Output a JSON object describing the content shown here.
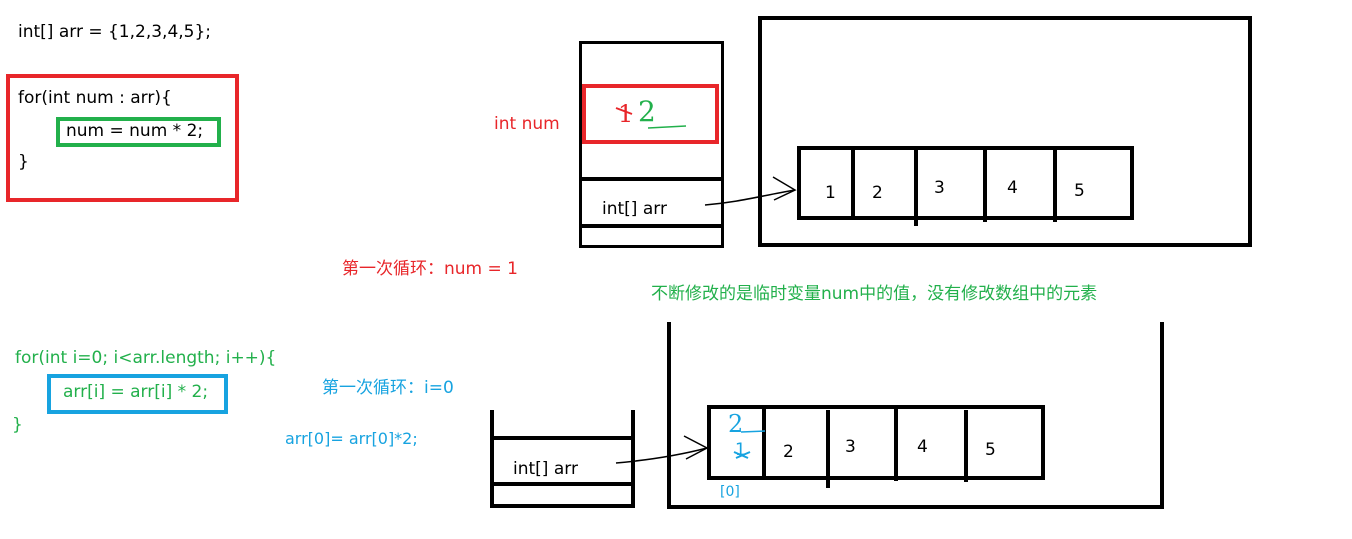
{
  "colors": {
    "black": "#000000",
    "red": "#e8262a",
    "green": "#22b04b",
    "blue": "#17a3e0"
  },
  "code_top": {
    "declaration": "int[] arr = {1,2,3,4,5};",
    "for_line": "for(int num : arr){",
    "body": "num = num * 2;",
    "close": "}"
  },
  "code_bottom": {
    "for_line": "for(int i=0; i<arr.length; i++){",
    "body": "arr[i] = arr[i] * 2;",
    "close": "}"
  },
  "labels": {
    "int_num": "int num",
    "loop1_num": "第一次循环：num = 1",
    "note": "不断修改的是临时变量num中的值，没有修改数组中的元素",
    "loop1_i": "第一次循环：i=0",
    "assign": "arr[0]= arr[0]*2;",
    "index0": "[0]"
  },
  "stack_top": {
    "num_value_old": "1",
    "num_value_new": "2",
    "arr_label": "int[] arr"
  },
  "stack_bottom": {
    "arr_label": "int[] arr"
  },
  "array_top": [
    "1",
    "2",
    "3",
    "4",
    "5"
  ],
  "array_bottom": {
    "first_old": "1",
    "first_new": "2",
    "rest": [
      "2",
      "3",
      "4",
      "5"
    ]
  }
}
